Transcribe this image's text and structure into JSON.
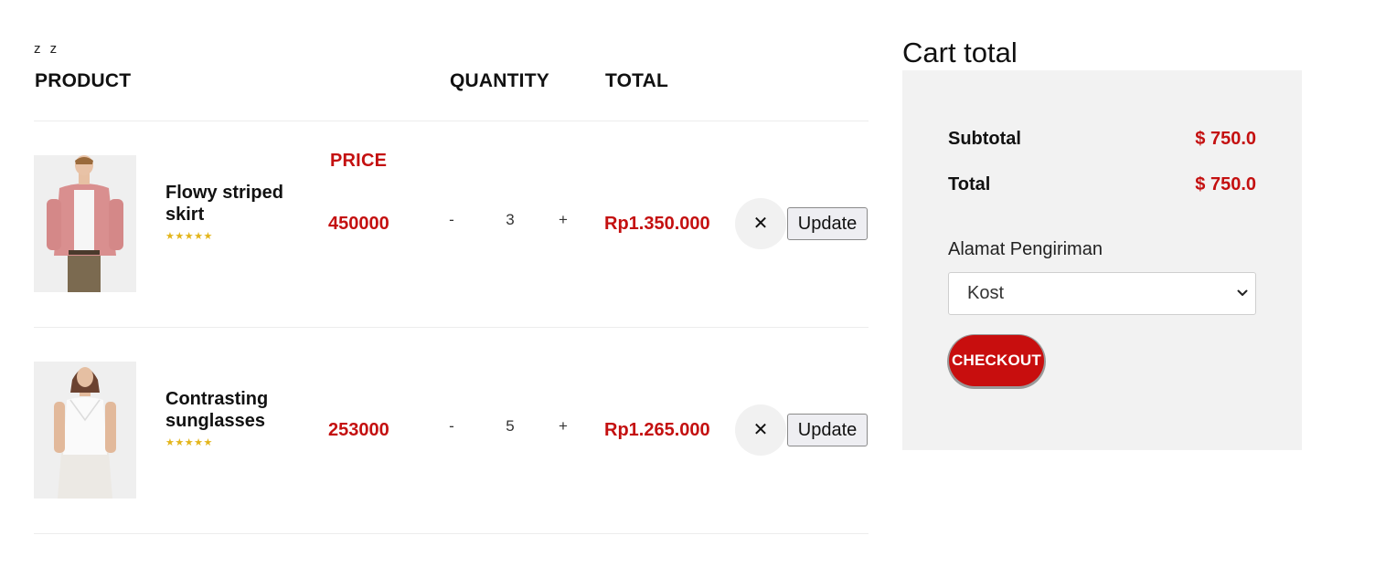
{
  "cart": {
    "marker": "z z",
    "headers": {
      "product": "PRODUCT",
      "price": "PRICE",
      "quantity": "QUANTITY",
      "total": "TOTAL"
    },
    "items": [
      {
        "name": "Flowy striped skirt",
        "stars": "★★★★★",
        "price": "450000",
        "decrement": "-",
        "quantity": "3",
        "increment": "+",
        "total": "Rp1.350.000",
        "remove": "✕",
        "update": "Update"
      },
      {
        "name": "Contrasting sunglasses",
        "stars": "★★★★★",
        "price": "253000",
        "decrement": "-",
        "quantity": "5",
        "increment": "+",
        "total": "Rp1.265.000",
        "remove": "✕",
        "update": "Update"
      }
    ]
  },
  "summary": {
    "title": "Cart total",
    "subtotal_label": "Subtotal",
    "subtotal_value": "$ 750.0",
    "total_label": "Total",
    "total_value": "$ 750.0",
    "address_label": "Alamat Pengiriman",
    "address_selected": "Kost",
    "checkout_label": "CHECKOUT"
  },
  "colors": {
    "accent_red": "#c41010",
    "checkout_red": "#c80e0e",
    "panel_bg": "#f2f2f2",
    "star_gold": "#e3b51b"
  },
  "icons": {
    "remove": "close-icon",
    "select": "chevron-down-icon",
    "rating": "star-icon"
  }
}
